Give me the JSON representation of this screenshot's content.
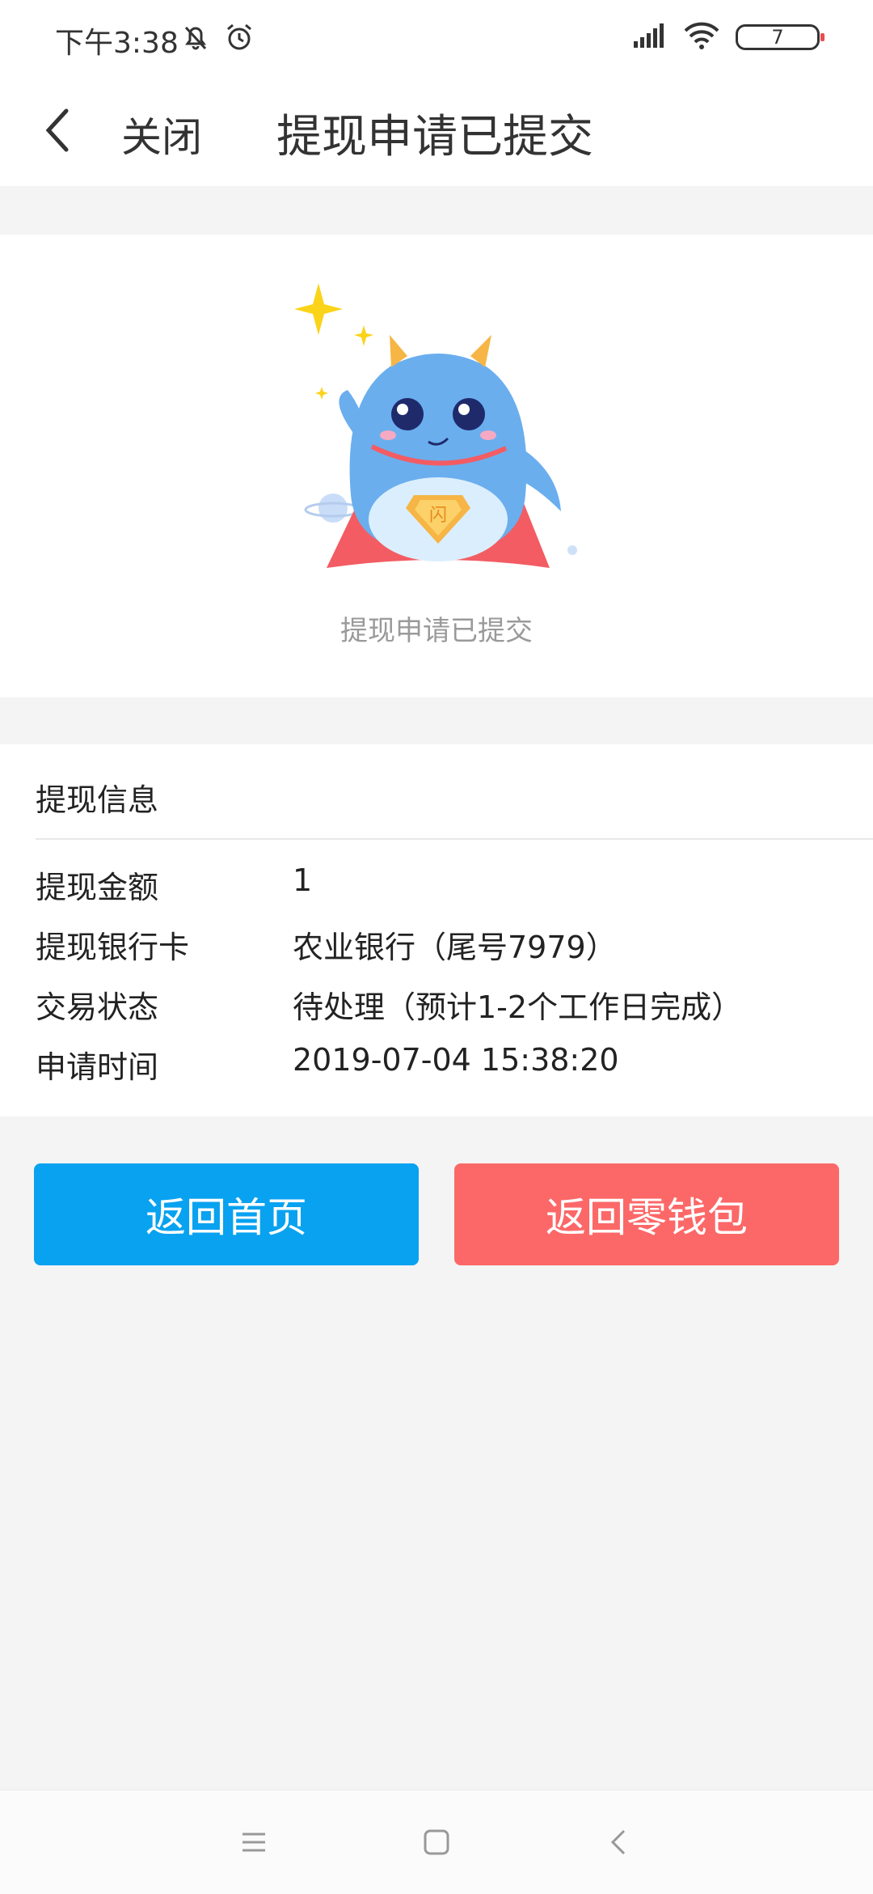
{
  "status_bar": {
    "time": "下午3:38",
    "battery_level": "7",
    "icons": [
      "mute-bell-icon",
      "alarm-icon",
      "signal-icon",
      "wifi-icon",
      "battery-icon"
    ]
  },
  "navbar": {
    "back_icon": "chevron-left-icon",
    "close_label": "关闭",
    "title": "提现申请已提交"
  },
  "hero": {
    "image": "superhero-mascot-illustration",
    "caption": "提现申请已提交"
  },
  "info": {
    "header": "提现信息",
    "rows": [
      {
        "label": "提现金额",
        "value": "1"
      },
      {
        "label": "提现银行卡",
        "value": "农业银行（尾号7979）"
      },
      {
        "label": "交易状态",
        "value": "待处理（预计1-2个工作日完成）"
      },
      {
        "label": "申请时间",
        "value": "2019-07-04 15:38:20"
      }
    ]
  },
  "buttons": {
    "home_label": "返回首页",
    "wallet_label": "返回零钱包"
  },
  "colors": {
    "primary_blue": "#08a2f0",
    "coral": "#fc6868",
    "page_bg": "#f4f4f4"
  },
  "system_nav": {
    "icons": [
      "menu-icon",
      "home-square-icon",
      "back-icon"
    ]
  }
}
